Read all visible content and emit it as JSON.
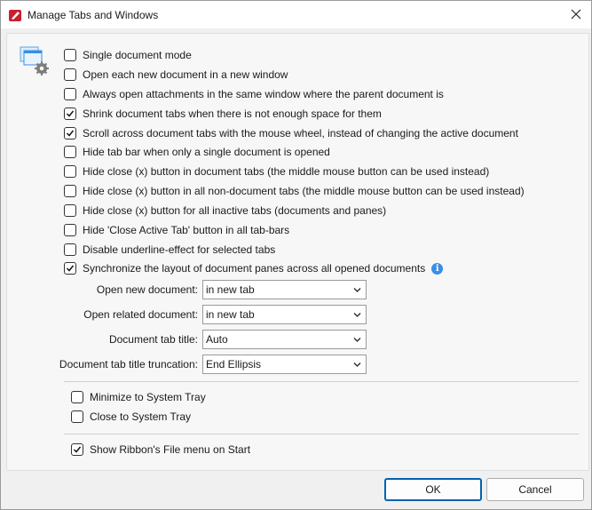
{
  "window": {
    "title": "Manage Tabs and Windows"
  },
  "options": [
    {
      "label": "Single document mode",
      "checked": false
    },
    {
      "label": "Open each new document in a new window",
      "checked": false
    },
    {
      "label": "Always open attachments in the same window where the parent document is",
      "checked": false
    },
    {
      "label": "Shrink document tabs when there is not enough space for them",
      "checked": true
    },
    {
      "label": "Scroll across document tabs with the mouse wheel, instead of changing the active document",
      "checked": true
    },
    {
      "label": "Hide tab bar when only a single document is opened",
      "checked": false
    },
    {
      "label": "Hide close (x) button in document tabs (the middle mouse button can be used instead)",
      "checked": false
    },
    {
      "label": "Hide close (x) button in all non-document tabs (the middle mouse button can be used instead)",
      "checked": false
    },
    {
      "label": "Hide close (x) button for all inactive tabs (documents and panes)",
      "checked": false
    },
    {
      "label": "Hide 'Close Active Tab' button in all tab-bars",
      "checked": false
    },
    {
      "label": "Disable underline-effect for selected tabs",
      "checked": false
    },
    {
      "label": "Synchronize the layout of document panes across all opened documents",
      "checked": true
    }
  ],
  "fields": [
    {
      "label": "Open new document:",
      "value": "in new tab"
    },
    {
      "label": "Open related document:",
      "value": "in new tab"
    },
    {
      "label": "Document tab title:",
      "value": "Auto"
    },
    {
      "label": "Document tab title truncation:",
      "value": "End Ellipsis"
    }
  ],
  "tray": [
    {
      "label": "Minimize to System Tray",
      "checked": false
    },
    {
      "label": "Close to System Tray",
      "checked": false
    }
  ],
  "ribbon": {
    "label": "Show Ribbon's File menu on Start",
    "checked": true
  },
  "buttons": {
    "ok": "OK",
    "cancel": "Cancel"
  },
  "colors": {
    "accent": "#0063b1",
    "info": "#3a8ee6",
    "app_icon": "#c8202f"
  }
}
